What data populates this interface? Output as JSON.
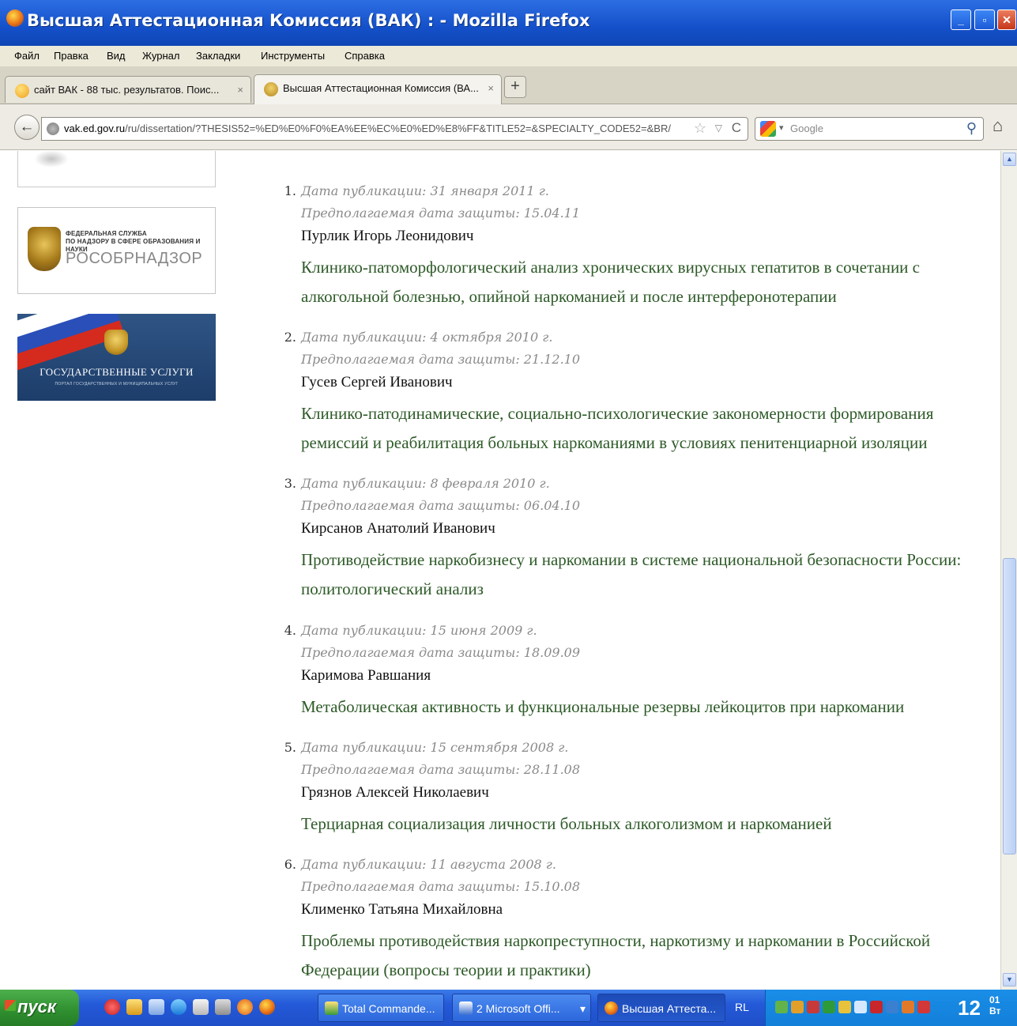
{
  "window": {
    "title": "Высшая Аттестационная Комиссия (ВАК) : - Mozilla Firefox",
    "min_label": "_",
    "max_label": "▫",
    "close_label": "✕"
  },
  "menu": [
    "Файл",
    "Правка",
    "Вид",
    "Журнал",
    "Закладки",
    "Инструменты",
    "Справка"
  ],
  "tabs": [
    {
      "label": "сайт ВАК - 88 тыс. результатов. Поис...",
      "close": "×"
    },
    {
      "label": "Высшая Аттестационная Комиссия (ВА...",
      "close": "×"
    }
  ],
  "newtab_label": "+",
  "nav": {
    "back": "←",
    "url_domain": "vak.ed.gov.ru",
    "url_path": "/ru/dissertation/?THESIS52=%ED%E0%F0%EA%EE%EC%E0%ED%E8%FF&TITLE52=&SPECIALTY_CODE52=&BR/",
    "star": "☆",
    "drop": "▽",
    "reload": "C",
    "search_placeholder": "Google",
    "search_drop": "▾",
    "search_icon": "⚲",
    "home": "⌂"
  },
  "sidebar": {
    "rosobr_line1": "ФЕДЕРАЛЬНАЯ СЛУЖБА",
    "rosobr_line2": "ПО НАДЗОРУ В СФЕРЕ ОБРАЗОВАНИЯ И НАУКИ",
    "rosobr_name": "РОСОБРНАДЗОР",
    "gosus_name": "ГОСУДАРСТВЕННЫЕ УСЛУГИ",
    "gosus_sub": "ПОРТАЛ ГОСУДАРСТВЕННЫХ И МУНИЦИПАЛЬНЫХ УСЛУГ"
  },
  "results": [
    {
      "num": "1.",
      "pub": "Дата публикации: 31 января 2011 г.",
      "def": "Предполагаемая дата защиты: 15.04.11",
      "author": "Пурлик Игорь Леонидович",
      "title": "Клинико-патоморфологический анализ хронических вирусных гепатитов в сочетании с алкогольной болезнью, опийной наркоманией и после интерферонотерапии"
    },
    {
      "num": "2.",
      "pub": "Дата публикации: 4 октября 2010 г.",
      "def": "Предполагаемая дата защиты: 21.12.10",
      "author": "Гусев Сергей Иванович",
      "title": "Клинико-патодинамические, социально-психологические закономерности формирования ремиссий и реабилитация больных наркоманиями в условиях пенитенциарной изоляции"
    },
    {
      "num": "3.",
      "pub": "Дата публикации: 8 февраля 2010 г.",
      "def": "Предполагаемая дата защиты: 06.04.10",
      "author": "Кирсанов Анатолий Иванович",
      "title": "Противодействие наркобизнесу и наркомании в системе национальной безопасности России: политологический анализ"
    },
    {
      "num": "4.",
      "pub": "Дата публикации: 15 июня 2009 г.",
      "def": "Предполагаемая дата защиты: 18.09.09",
      "author": "Каримова Равшания",
      "title": "Метаболическая активность и функциональные резервы лейкоцитов при наркомании"
    },
    {
      "num": "5.",
      "pub": "Дата публикации: 15 сентября 2008 г.",
      "def": "Предполагаемая дата защиты: 28.11.08",
      "author": "Грязнов Алексей Николаевич",
      "title": "Терциарная социализация личности больных алкоголизмом и наркоманией"
    },
    {
      "num": "6.",
      "pub": "Дата публикации: 11 августа 2008 г.",
      "def": "Предполагаемая дата защиты: 15.10.08",
      "author": "Клименко Татьяна Михайловна",
      "title": "Проблемы противодействия наркопреступности, наркотизму и наркомании в Российской Федерации (вопросы теории и практики)"
    }
  ],
  "scroll": {
    "up": "▲",
    "down": "▼"
  },
  "taskbar": {
    "start": "пуск",
    "tasks": [
      "Total Commande...",
      "2 Microsoft Offi...",
      "Высшая Аттеста..."
    ],
    "task_drop": "▾",
    "lang": "RL",
    "clock_hour": "12",
    "clock_min": "01",
    "clock_day": "Вт"
  },
  "colors": {
    "title_link": "#2d5a27",
    "meta_gray": "#8a8a8a",
    "xp_blue": "#2459d8",
    "start_green": "#2f8e2f"
  }
}
